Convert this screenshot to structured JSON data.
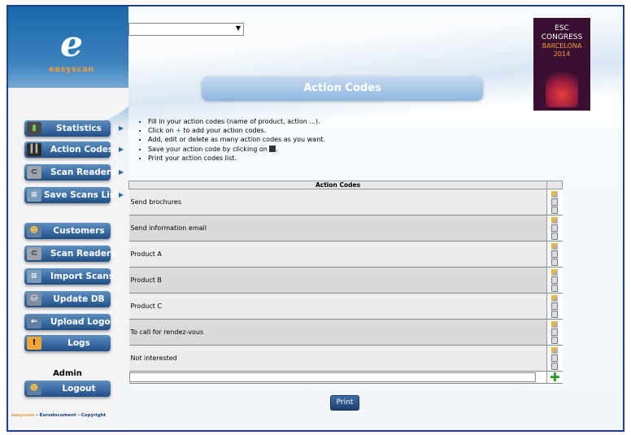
{
  "logo": {
    "letter": "e",
    "text": "easyscan"
  },
  "top_select": {
    "value": ""
  },
  "event_badge": {
    "line1": "ESC",
    "line2": "CONGRESS",
    "line3": "BARCELONA",
    "line4": "2014"
  },
  "page_title": "Action Codes",
  "nav_primary": [
    {
      "label": "Statistics"
    },
    {
      "label": "Action Codes"
    },
    {
      "label": "Scan Readers"
    },
    {
      "label": "Save Scans List"
    }
  ],
  "nav_secondary": [
    {
      "label": "Customers"
    },
    {
      "label": "Scan Readers"
    },
    {
      "label": "Import Scans"
    },
    {
      "label": "Update DB"
    },
    {
      "label": "Upload Logo"
    },
    {
      "label": "Logs"
    }
  ],
  "user": {
    "name": "Admin",
    "logout_label": "Logout"
  },
  "footer": {
    "brand": "easyscan",
    "text": " - Eurodocument - Copyright"
  },
  "instructions": {
    "i1": "Fill in your action codes (name of product, action ...).",
    "i2_pre": "Click on ",
    "i2_post": " to add your action codes.",
    "i3": "Add, edit or delete as many action codes as you want.",
    "i4_pre": "Save your action code by clicking on ",
    "i4_post": ".",
    "i5": "Print your action codes list."
  },
  "table": {
    "header": "Action Codes",
    "rows": [
      "Send brochures",
      "Send information email",
      "Product A",
      "Product B",
      "Product C",
      "To call for rendez-vous",
      "Not interested"
    ],
    "new_value": ""
  },
  "print_label": "Print",
  "colors": {
    "nav_button": "#2a5a94",
    "accent_orange": "#f29a3a",
    "frame_border": "#1f3f8c"
  }
}
